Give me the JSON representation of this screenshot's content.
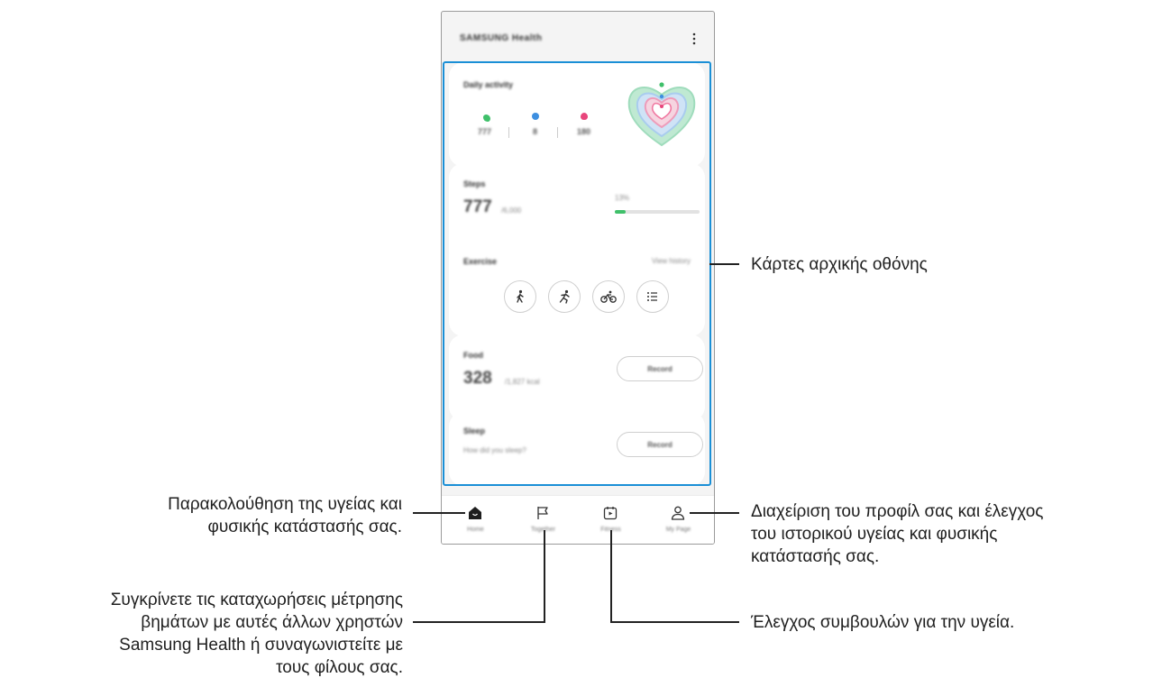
{
  "app": {
    "title": "SAMSUNG Health",
    "more_icon": "more-vert-icon"
  },
  "cards": {
    "daily_activity": {
      "title": "Daily activity",
      "stats": [
        {
          "icon": "steps-icon",
          "color": "#3fc06a",
          "value": "777"
        },
        {
          "icon": "active-time-icon",
          "color": "#3d8fe0",
          "value": "8"
        },
        {
          "icon": "calories-icon",
          "color": "#e8467c",
          "value": "180"
        }
      ],
      "ring_icon": "activity-heart-rings-icon"
    },
    "steps": {
      "title": "Steps",
      "value": "777",
      "unit": "/6,000",
      "percent_label": "13%",
      "progress": 0.13
    },
    "exercise": {
      "title": "Exercise",
      "link": "View history",
      "buttons": [
        {
          "icon": "walking-icon"
        },
        {
          "icon": "running-icon"
        },
        {
          "icon": "cycling-icon"
        },
        {
          "icon": "list-icon"
        }
      ]
    },
    "food": {
      "title": "Food",
      "value": "328",
      "unit": "/1,827 kcal",
      "button": "Record"
    },
    "sleep": {
      "title": "Sleep",
      "question": "How did you sleep?",
      "button": "Record"
    }
  },
  "nav": [
    {
      "label": "Home",
      "icon": "home-icon"
    },
    {
      "label": "Together",
      "icon": "flag-icon"
    },
    {
      "label": "Fitness",
      "icon": "fitness-video-icon"
    },
    {
      "label": "My Page",
      "icon": "person-icon"
    }
  ],
  "callouts": {
    "home_cards": "Κάρτες αρχικής οθόνης",
    "home_tab": [
      "Παρακολούθηση της υγείας και",
      "φυσικής κατάστασής σας."
    ],
    "my_page": [
      "Διαχείριση του προφίλ σας και έλεγχος",
      "του ιστορικού υγείας και φυσικής",
      "κατάστασής σας."
    ],
    "together": [
      "Συγκρίνετε τις καταχωρήσεις μέτρησης",
      "βημάτων με αυτές άλλων χρηστών",
      "Samsung Health ή συναγωνιστείτε με",
      "τους φίλους σας."
    ],
    "fitness": "Έλεγχος συμβουλών για την υγεία."
  },
  "colors": {
    "highlight": "#1a8fd6",
    "steps_green": "#3fc06a",
    "phone_bg": "#f4f4f4"
  }
}
